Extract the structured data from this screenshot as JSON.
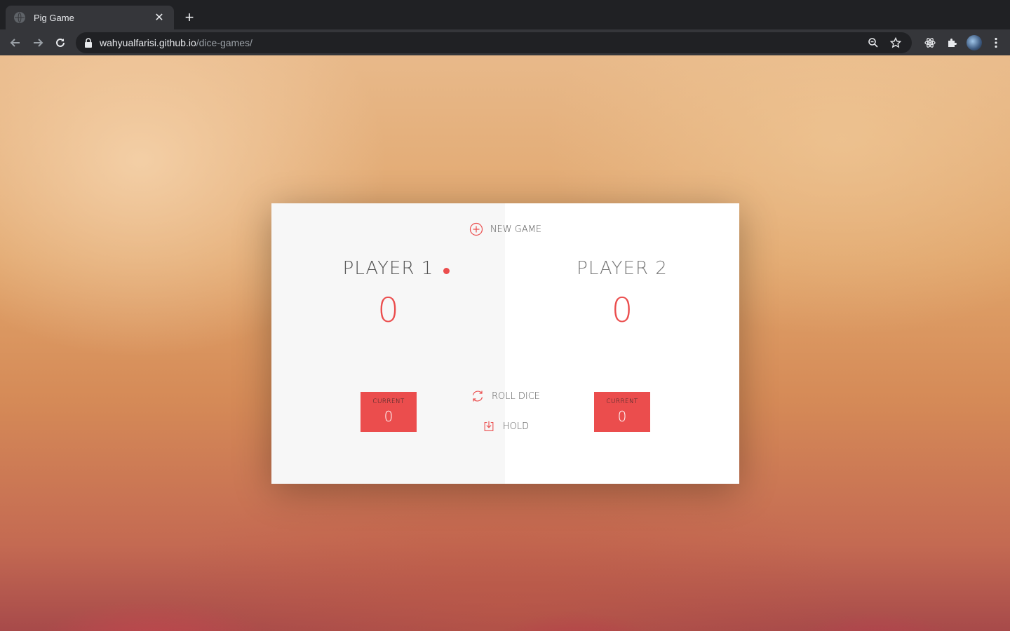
{
  "browser": {
    "tab_title": "Pig Game",
    "url_host": "wahyualfarisi.github.io",
    "url_path": "/dice-games/"
  },
  "game": {
    "new_game_label": "NEW GAME",
    "roll_dice_label": "ROLL DICE",
    "hold_label": "HOLD",
    "accent_color": "#EB4D4D",
    "active_player": 1,
    "players": [
      {
        "name": "PLAYER 1",
        "score": "0",
        "current_label": "CURRENT",
        "current_score": "0"
      },
      {
        "name": "PLAYER 2",
        "score": "0",
        "current_label": "CURRENT",
        "current_score": "0"
      }
    ]
  },
  "icons": {
    "new_game": "plus-circle-icon",
    "roll_dice": "refresh-icon",
    "hold": "download-icon"
  }
}
